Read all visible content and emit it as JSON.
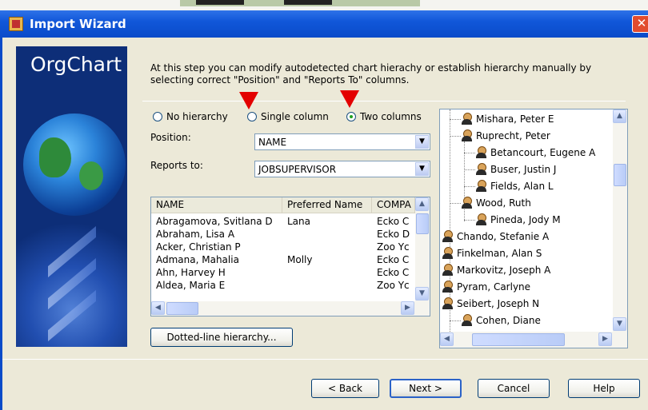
{
  "window": {
    "title": "Import Wizard",
    "close_glyph": "✕"
  },
  "sidebar": {
    "brand": "OrgChart"
  },
  "description": "At this step you can modify autodetected chart hierachy or establish hierarchy manually by selecting correct \"Position\" and \"Reports To\" columns.",
  "hierarchy": {
    "options": [
      {
        "label": "No hierarchy",
        "selected": false
      },
      {
        "label": "Single column",
        "selected": false
      },
      {
        "label": "Two columns",
        "selected": true
      }
    ]
  },
  "fields": {
    "position_label": "Position:",
    "position_value": "NAME",
    "reports_to_label": "Reports to:",
    "reports_to_value": "JOBSUPERVISOR"
  },
  "table": {
    "columns": [
      "NAME",
      "Preferred Name",
      "COMPA"
    ],
    "rows": [
      {
        "name": "Abragamova, Svitlana D",
        "preferred": "Lana",
        "company": "Ecko C"
      },
      {
        "name": "Abraham, Lisa A",
        "preferred": "",
        "company": "Ecko D"
      },
      {
        "name": "Acker, Christian P",
        "preferred": "",
        "company": "Zoo Yc"
      },
      {
        "name": "Admana, Mahalia",
        "preferred": "Molly",
        "company": "Ecko C"
      },
      {
        "name": "Ahn, Harvey H",
        "preferred": "",
        "company": "Ecko C"
      },
      {
        "name": "Aldea, Maria E",
        "preferred": "",
        "company": "Zoo Yc"
      }
    ]
  },
  "dotted_button": "Dotted-line hierarchy...",
  "tree": {
    "nodes": [
      {
        "label": "Mishara, Peter E",
        "level": 1
      },
      {
        "label": "Ruprecht, Peter",
        "level": 1
      },
      {
        "label": "Betancourt, Eugene A",
        "level": 2
      },
      {
        "label": "Buser, Justin J",
        "level": 2
      },
      {
        "label": "Fields, Alan L",
        "level": 2
      },
      {
        "label": "Wood, Ruth",
        "level": 1
      },
      {
        "label": "Pineda, Jody M",
        "level": 2
      },
      {
        "label": "Chando, Stefanie A",
        "level": 0
      },
      {
        "label": "Finkelman, Alan S",
        "level": 0
      },
      {
        "label": "Markovitz, Joseph A",
        "level": 0
      },
      {
        "label": "Pyram, Carlyne",
        "level": 0
      },
      {
        "label": "Seibert, Joseph N",
        "level": 0
      },
      {
        "label": "Cohen, Diane",
        "level": 1
      }
    ]
  },
  "footer": {
    "back": "< Back",
    "next": "Next >",
    "cancel": "Cancel",
    "help": "Help"
  }
}
